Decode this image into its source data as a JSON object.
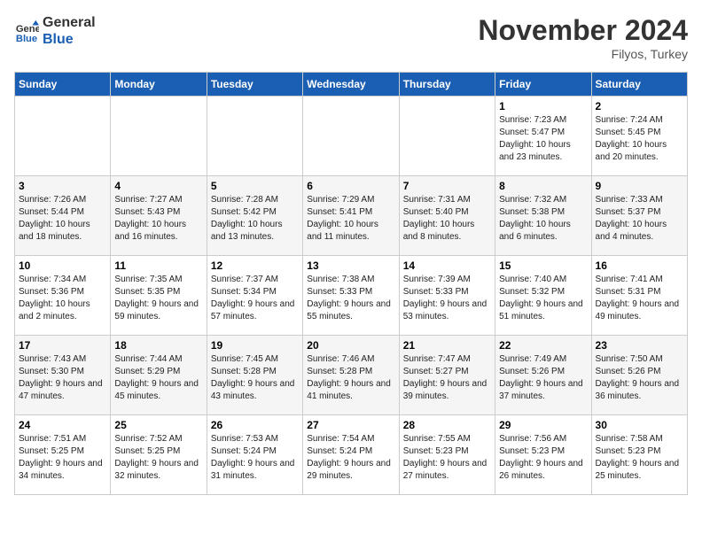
{
  "header": {
    "logo_line1": "General",
    "logo_line2": "Blue",
    "month": "November 2024",
    "location": "Filyos, Turkey"
  },
  "weekdays": [
    "Sunday",
    "Monday",
    "Tuesday",
    "Wednesday",
    "Thursday",
    "Friday",
    "Saturday"
  ],
  "weeks": [
    [
      {
        "day": "",
        "info": ""
      },
      {
        "day": "",
        "info": ""
      },
      {
        "day": "",
        "info": ""
      },
      {
        "day": "",
        "info": ""
      },
      {
        "day": "",
        "info": ""
      },
      {
        "day": "1",
        "info": "Sunrise: 7:23 AM\nSunset: 5:47 PM\nDaylight: 10 hours and 23 minutes."
      },
      {
        "day": "2",
        "info": "Sunrise: 7:24 AM\nSunset: 5:45 PM\nDaylight: 10 hours and 20 minutes."
      }
    ],
    [
      {
        "day": "3",
        "info": "Sunrise: 7:26 AM\nSunset: 5:44 PM\nDaylight: 10 hours and 18 minutes."
      },
      {
        "day": "4",
        "info": "Sunrise: 7:27 AM\nSunset: 5:43 PM\nDaylight: 10 hours and 16 minutes."
      },
      {
        "day": "5",
        "info": "Sunrise: 7:28 AM\nSunset: 5:42 PM\nDaylight: 10 hours and 13 minutes."
      },
      {
        "day": "6",
        "info": "Sunrise: 7:29 AM\nSunset: 5:41 PM\nDaylight: 10 hours and 11 minutes."
      },
      {
        "day": "7",
        "info": "Sunrise: 7:31 AM\nSunset: 5:40 PM\nDaylight: 10 hours and 8 minutes."
      },
      {
        "day": "8",
        "info": "Sunrise: 7:32 AM\nSunset: 5:38 PM\nDaylight: 10 hours and 6 minutes."
      },
      {
        "day": "9",
        "info": "Sunrise: 7:33 AM\nSunset: 5:37 PM\nDaylight: 10 hours and 4 minutes."
      }
    ],
    [
      {
        "day": "10",
        "info": "Sunrise: 7:34 AM\nSunset: 5:36 PM\nDaylight: 10 hours and 2 minutes."
      },
      {
        "day": "11",
        "info": "Sunrise: 7:35 AM\nSunset: 5:35 PM\nDaylight: 9 hours and 59 minutes."
      },
      {
        "day": "12",
        "info": "Sunrise: 7:37 AM\nSunset: 5:34 PM\nDaylight: 9 hours and 57 minutes."
      },
      {
        "day": "13",
        "info": "Sunrise: 7:38 AM\nSunset: 5:33 PM\nDaylight: 9 hours and 55 minutes."
      },
      {
        "day": "14",
        "info": "Sunrise: 7:39 AM\nSunset: 5:33 PM\nDaylight: 9 hours and 53 minutes."
      },
      {
        "day": "15",
        "info": "Sunrise: 7:40 AM\nSunset: 5:32 PM\nDaylight: 9 hours and 51 minutes."
      },
      {
        "day": "16",
        "info": "Sunrise: 7:41 AM\nSunset: 5:31 PM\nDaylight: 9 hours and 49 minutes."
      }
    ],
    [
      {
        "day": "17",
        "info": "Sunrise: 7:43 AM\nSunset: 5:30 PM\nDaylight: 9 hours and 47 minutes."
      },
      {
        "day": "18",
        "info": "Sunrise: 7:44 AM\nSunset: 5:29 PM\nDaylight: 9 hours and 45 minutes."
      },
      {
        "day": "19",
        "info": "Sunrise: 7:45 AM\nSunset: 5:28 PM\nDaylight: 9 hours and 43 minutes."
      },
      {
        "day": "20",
        "info": "Sunrise: 7:46 AM\nSunset: 5:28 PM\nDaylight: 9 hours and 41 minutes."
      },
      {
        "day": "21",
        "info": "Sunrise: 7:47 AM\nSunset: 5:27 PM\nDaylight: 9 hours and 39 minutes."
      },
      {
        "day": "22",
        "info": "Sunrise: 7:49 AM\nSunset: 5:26 PM\nDaylight: 9 hours and 37 minutes."
      },
      {
        "day": "23",
        "info": "Sunrise: 7:50 AM\nSunset: 5:26 PM\nDaylight: 9 hours and 36 minutes."
      }
    ],
    [
      {
        "day": "24",
        "info": "Sunrise: 7:51 AM\nSunset: 5:25 PM\nDaylight: 9 hours and 34 minutes."
      },
      {
        "day": "25",
        "info": "Sunrise: 7:52 AM\nSunset: 5:25 PM\nDaylight: 9 hours and 32 minutes."
      },
      {
        "day": "26",
        "info": "Sunrise: 7:53 AM\nSunset: 5:24 PM\nDaylight: 9 hours and 31 minutes."
      },
      {
        "day": "27",
        "info": "Sunrise: 7:54 AM\nSunset: 5:24 PM\nDaylight: 9 hours and 29 minutes."
      },
      {
        "day": "28",
        "info": "Sunrise: 7:55 AM\nSunset: 5:23 PM\nDaylight: 9 hours and 27 minutes."
      },
      {
        "day": "29",
        "info": "Sunrise: 7:56 AM\nSunset: 5:23 PM\nDaylight: 9 hours and 26 minutes."
      },
      {
        "day": "30",
        "info": "Sunrise: 7:58 AM\nSunset: 5:23 PM\nDaylight: 9 hours and 25 minutes."
      }
    ]
  ]
}
